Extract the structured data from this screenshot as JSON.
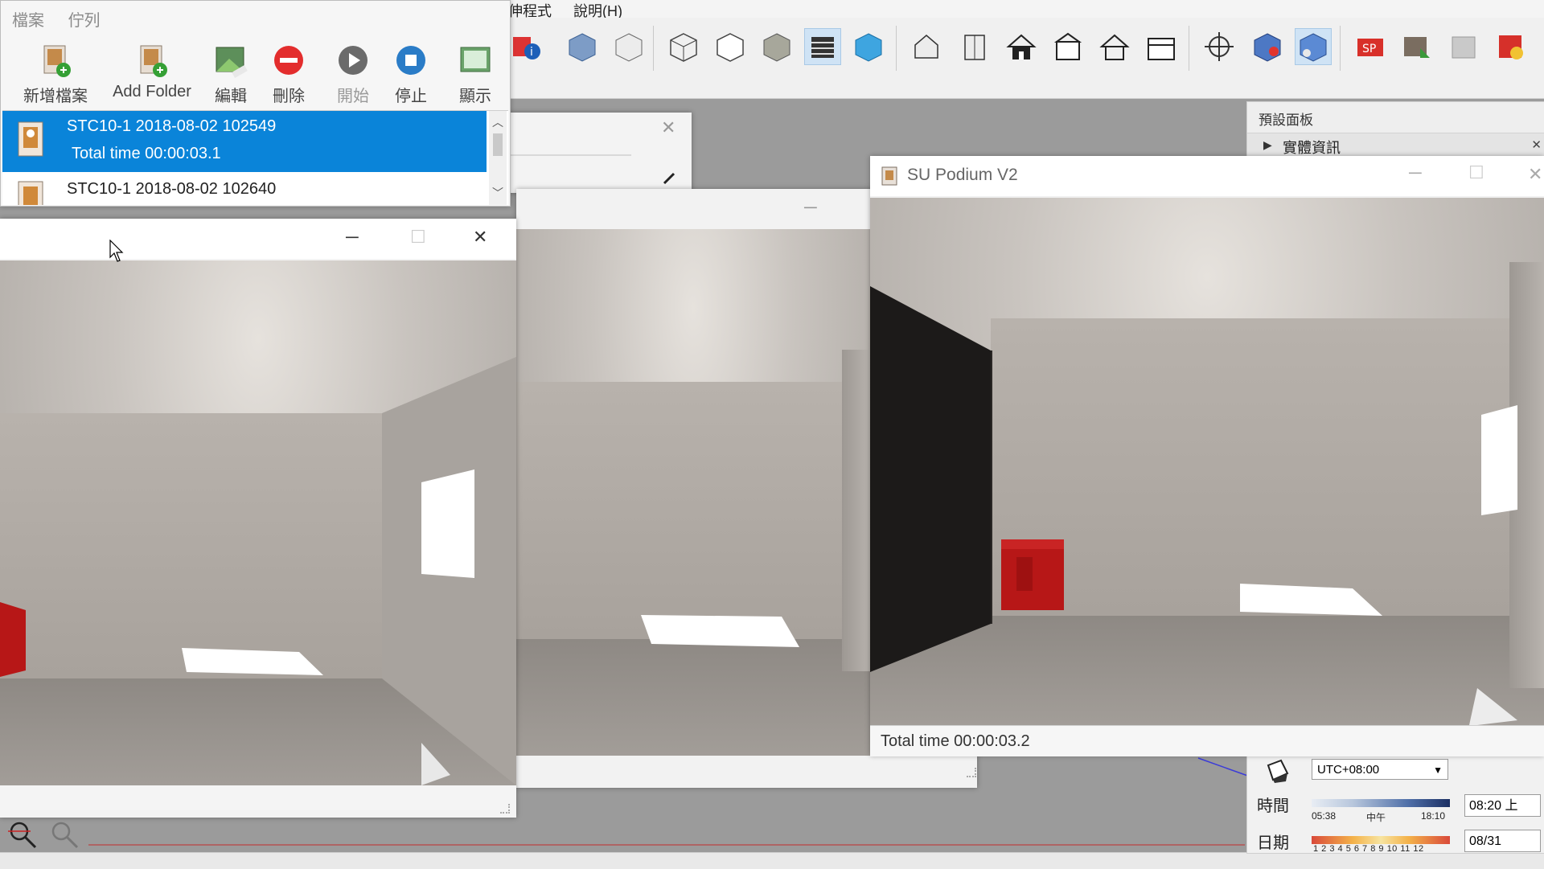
{
  "sketchup": {
    "menu": [
      "伸程式",
      "說明(H)"
    ],
    "tray_title": "預設面板",
    "tray_section": "實體資訊",
    "shadow": {
      "timezone": "UTC+08:00",
      "time_label": "時間",
      "date_label": "日期",
      "time_start": "05:38",
      "time_mid": "中午",
      "time_end": "18:10",
      "month_ticks": "1 2 3 4 5 6 7 8 9 10 11 12",
      "time_value": "08:20 上",
      "date_value": "08/31"
    }
  },
  "queue": {
    "menu": [
      "檔案",
      "佇列"
    ],
    "toolbar": [
      {
        "label": "新增檔案",
        "icon": "add-file-icon",
        "disabled": false
      },
      {
        "label": "Add Folder",
        "icon": "add-folder-icon",
        "disabled": false
      },
      {
        "label": "編輯",
        "icon": "edit-icon",
        "disabled": false
      },
      {
        "label": "刪除",
        "icon": "delete-icon",
        "disabled": false
      },
      {
        "label": "開始",
        "icon": "play-icon",
        "disabled": true
      },
      {
        "label": "停止",
        "icon": "stop-icon",
        "disabled": false
      },
      {
        "label": "顯示",
        "icon": "display-icon",
        "disabled": false
      }
    ],
    "items": [
      {
        "name": "STC10-1 2018-08-02 102549",
        "detail": "Total time 00:00:03.1"
      },
      {
        "name": "STC10-1 2018-08-02 102640"
      }
    ]
  },
  "podium": {
    "title": "SU Podium V2",
    "status": "Total time 00:00:03.2"
  },
  "colors": {
    "selection": "#0a84d9",
    "cube_red": "#b71717"
  }
}
